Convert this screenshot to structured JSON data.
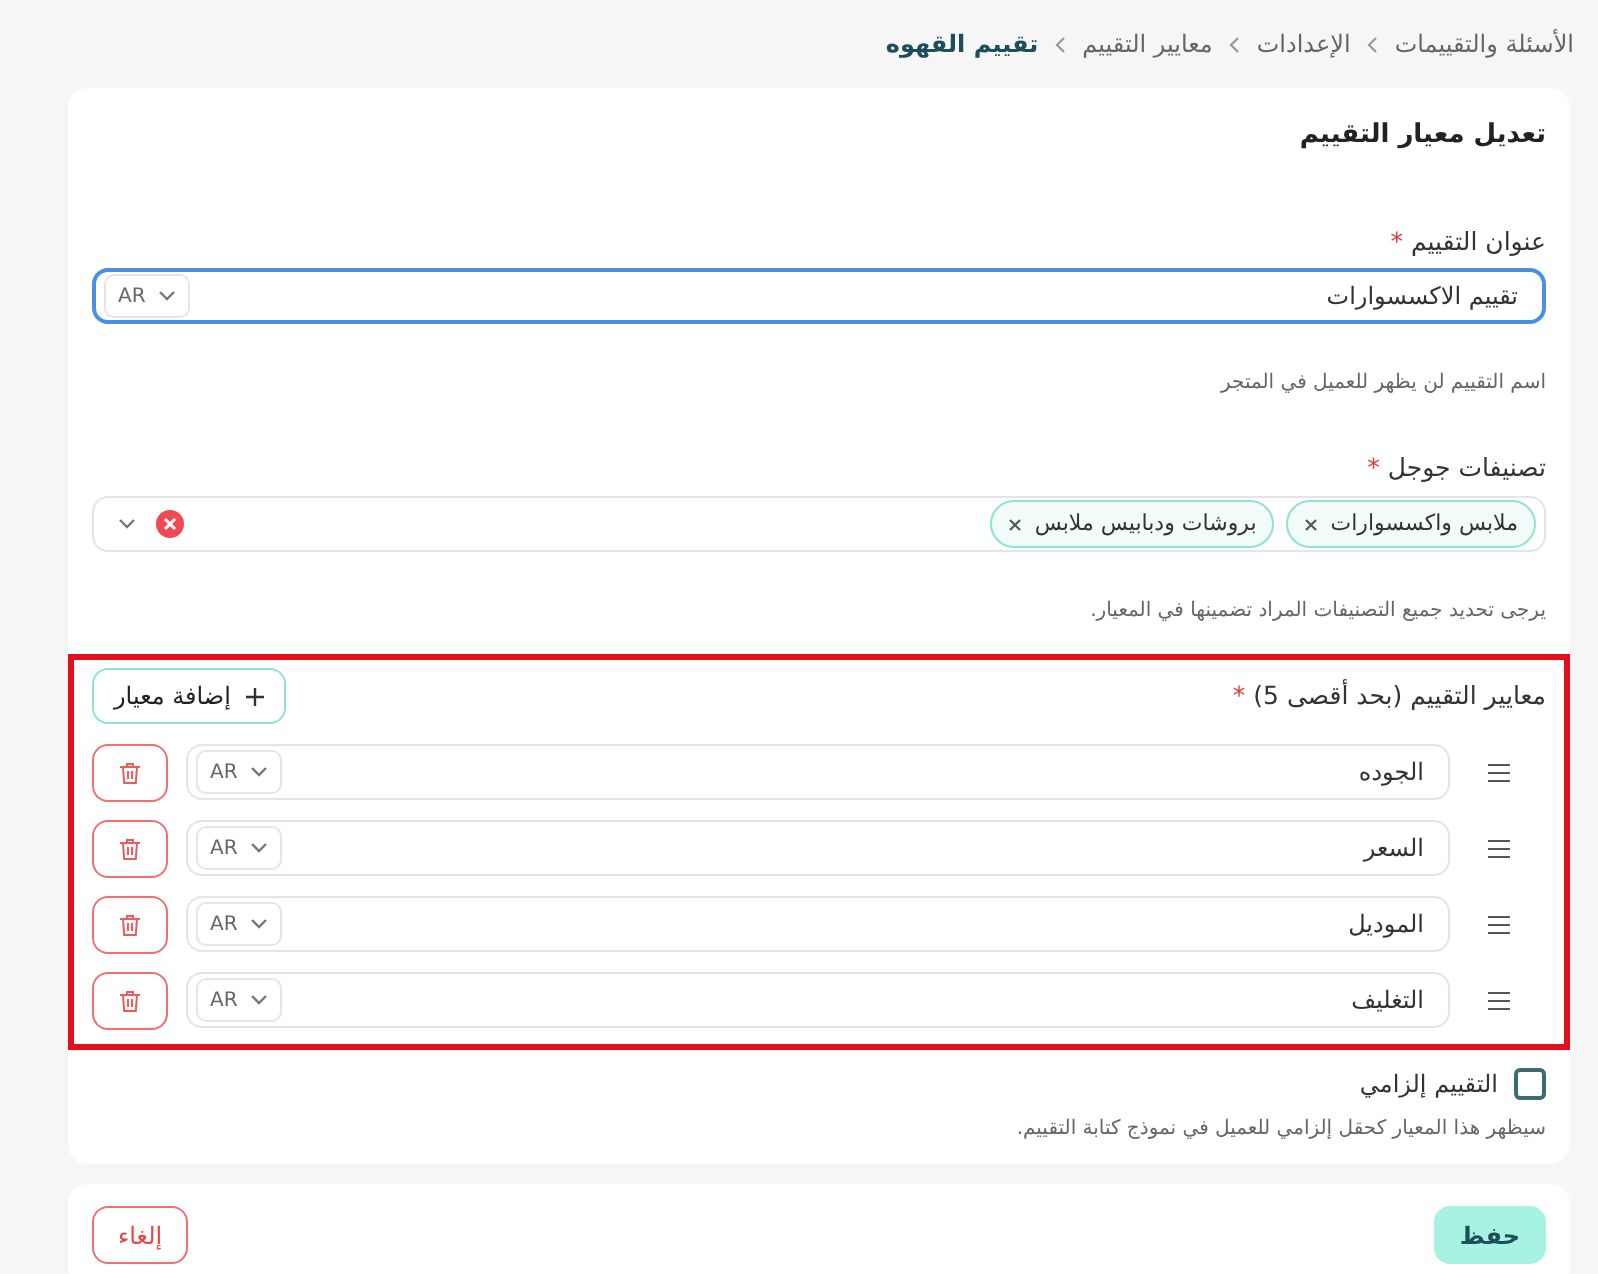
{
  "breadcrumb": [
    {
      "label": "الأسئلة والتقييمات",
      "selected": false
    },
    {
      "label": "الإعدادات",
      "selected": false
    },
    {
      "label": "معايير التقييم",
      "selected": false
    },
    {
      "label": "تقييم القهوه",
      "selected": true
    }
  ],
  "card_title": "تعديل معيار التقييم",
  "title_field": {
    "label": "عنوان التقييم",
    "required_mark": "*",
    "value": "تقييم الاكسسوارات",
    "language": "AR",
    "focused": true,
    "hint": "اسم التقييم لن يظهر للعميل في المتجر"
  },
  "categories_field": {
    "label": "تصنيفات جوجل",
    "required_mark": "*",
    "tags": [
      "ملابس واكسسوارات",
      "بروشات ودبابيس ملابس"
    ],
    "hint": "يرجى تحديد جميع التصنيفات المراد تضمينها في المعيار."
  },
  "criteria": {
    "label": "معايير التقييم (بحد أقصى 5)",
    "required_mark": "*",
    "highlighted": true,
    "add_button": "إضافة معيار",
    "items": [
      {
        "value": "الجوده",
        "language": "AR"
      },
      {
        "value": "السعر",
        "language": "AR"
      },
      {
        "value": "الموديل",
        "language": "AR"
      },
      {
        "value": "التغليف",
        "language": "AR"
      }
    ]
  },
  "mandatory": {
    "label": "التقييم إلزامي",
    "checked": false,
    "hint": "سيظهر هذا المعيار كحقل إلزامي للعميل في نموذج كتابة التقييم."
  },
  "buttons": [
    {
      "label": "حفظ",
      "kind": "primary"
    },
    {
      "label": "إلغاء",
      "kind": "cancel"
    }
  ]
}
